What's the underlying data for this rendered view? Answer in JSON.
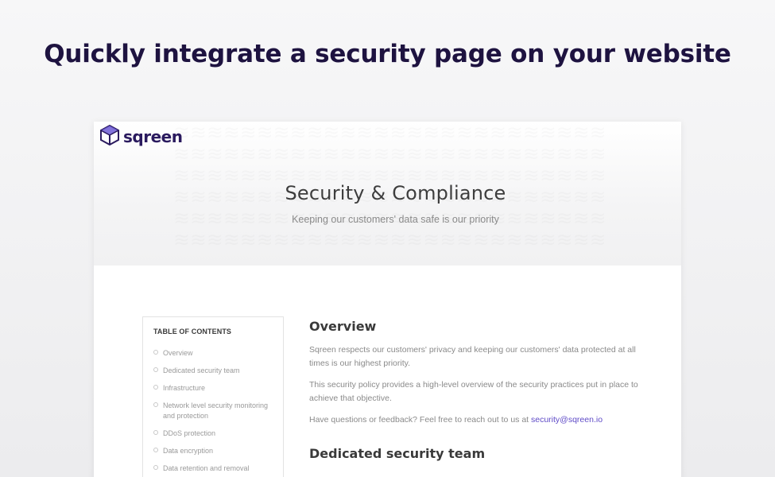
{
  "headline": "Quickly integrate a security page on your website",
  "logo": {
    "icon": "sqreen-cube-icon",
    "text": "sqreen",
    "color": "#2a1a5e",
    "accent": "#6c5bd4"
  },
  "hero": {
    "title": "Security & Compliance",
    "subtitle": "Keeping our customers' data safe is our priority"
  },
  "toc": {
    "title": "TABLE OF CONTENTS",
    "items": [
      {
        "label": "Overview"
      },
      {
        "label": "Dedicated security team"
      },
      {
        "label": "Infrastructure"
      },
      {
        "label": "Network level security monitoring and protection"
      },
      {
        "label": "DDoS protection"
      },
      {
        "label": "Data encryption"
      },
      {
        "label": "Data retention and removal"
      }
    ]
  },
  "content": {
    "overview_heading": "Overview",
    "overview_p1": "Sqreen respects our customers' privacy and keeping our customers' data protected at all times is our highest priority.",
    "overview_p2": "This security policy provides a high-level overview of the security practices put in place to achieve that objective.",
    "overview_p3_prefix": "Have questions or feedback? Feel free to reach out to us at ",
    "overview_p3_link": "security@sqreen.io",
    "team_heading": "Dedicated security team"
  },
  "colors": {
    "headline": "#1e1340",
    "link": "#5f4bc7"
  }
}
